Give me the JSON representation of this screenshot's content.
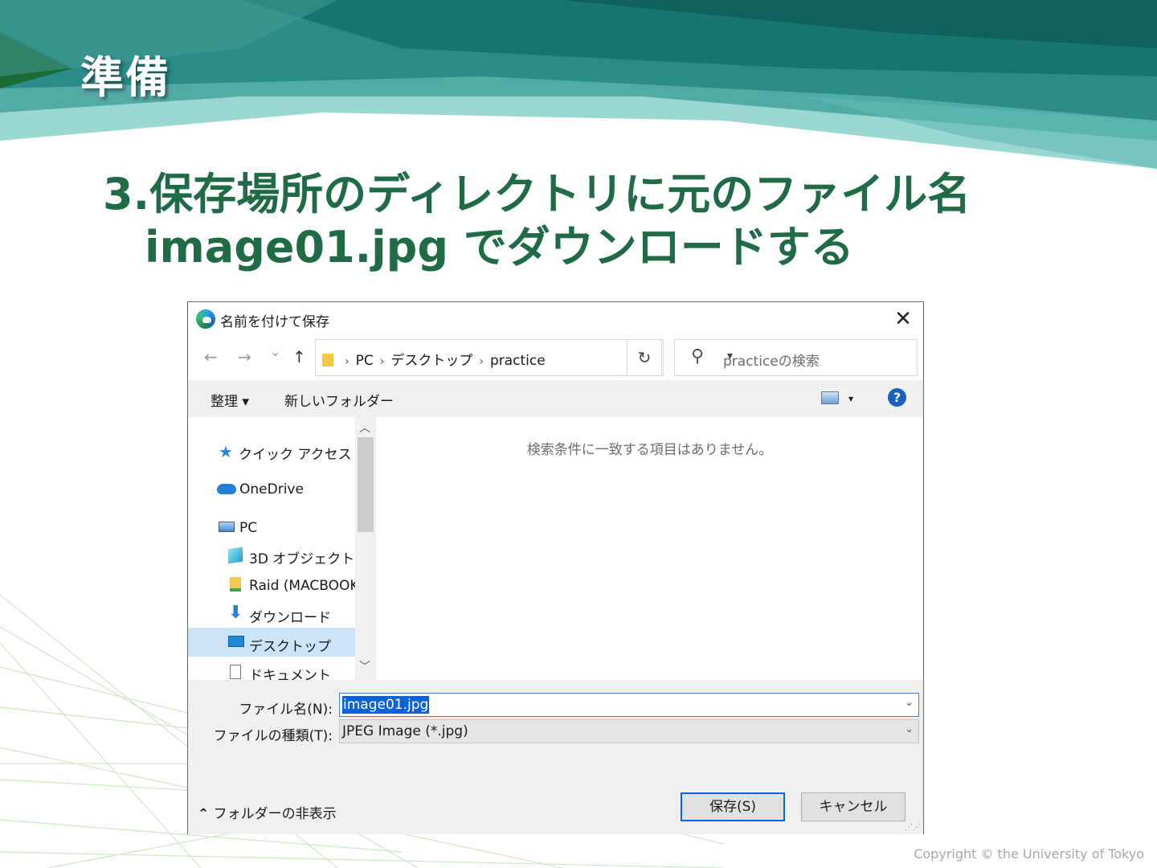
{
  "slide": {
    "title": "準備",
    "headline_line1": "3.保存場所のディレクトリに元のファイル名",
    "headline_line2": "image01.jpg でダウンロードする",
    "copyright": "Copyright © the University of Tokyo"
  },
  "dialog": {
    "title": "名前を付けて保存",
    "close_glyph": "✕",
    "nav": {
      "back": "←",
      "forward": "→",
      "recent": "⌄",
      "up": "↑"
    },
    "breadcrumb": [
      "PC",
      "デスクトップ",
      "practice"
    ],
    "refresh_glyph": "↻",
    "search_placeholder": "practiceの検索",
    "toolbar": {
      "organize": "整理 ▾",
      "new_folder": "新しいフォルダー",
      "view_arrow": "▾",
      "help": "?"
    },
    "nav_pane": [
      {
        "label": "クイック アクセス",
        "icon": "star-icon"
      },
      {
        "label": "OneDrive",
        "icon": "cloud-icon"
      },
      {
        "label": "PC",
        "icon": "computer-icon"
      },
      {
        "label": "3D オブジェクト",
        "icon": "cube-icon"
      },
      {
        "label": "Raid (MACBOOK",
        "icon": "drive-icon"
      },
      {
        "label": "ダウンロード",
        "icon": "download-icon"
      },
      {
        "label": "デスクトップ",
        "icon": "desktop-icon",
        "selected": true
      },
      {
        "label": "ドキュメント",
        "icon": "document-icon"
      }
    ],
    "empty_message": "検索条件に一致する項目はありません。",
    "filename_label": "ファイル名(N):",
    "filename_value": "image01.jpg",
    "filetype_label": "ファイルの種類(T):",
    "filetype_value": "JPEG Image (*.jpg)",
    "hide_folders": "フォルダーの非表示",
    "save_button": "保存(S)",
    "cancel_button": "キャンセル"
  },
  "colors": {
    "headline": "#1f6b46",
    "banner_dark": "#0e5f5c",
    "banner_light": "#8fd0cc",
    "selection": "#0a64d6"
  }
}
